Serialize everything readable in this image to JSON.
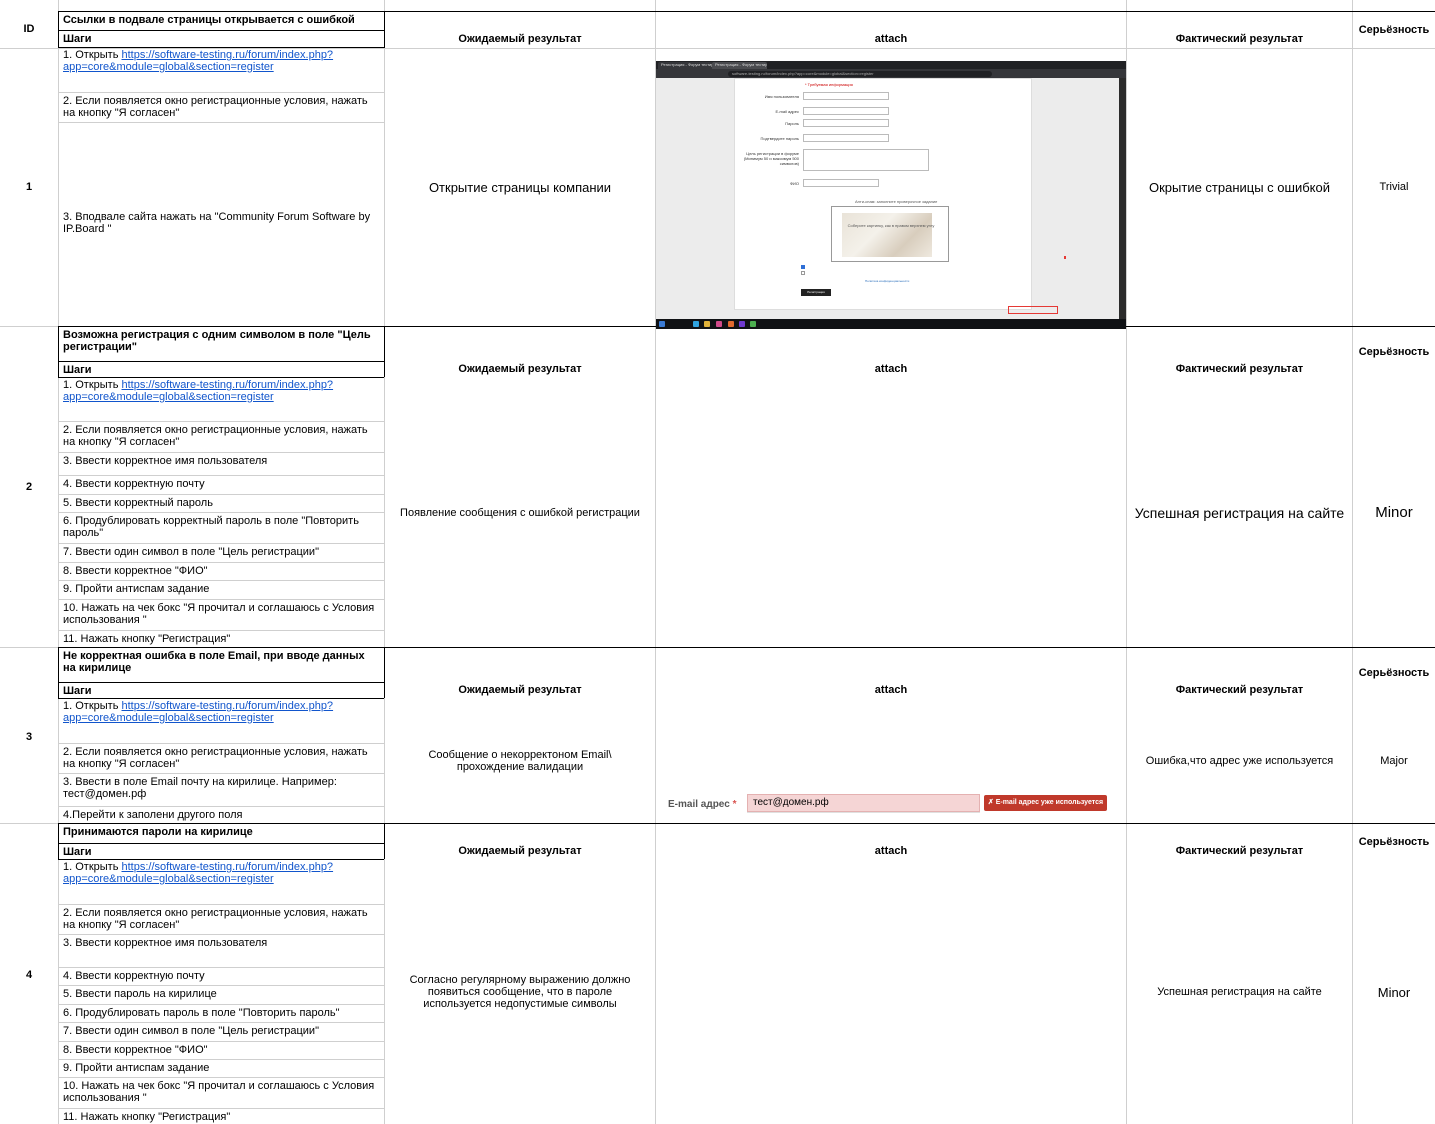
{
  "headers": {
    "id": "ID",
    "steps": "Шаги",
    "expected": "Ожидаемый результат",
    "attach": "attach",
    "actual": "Фактический результат",
    "severity": "Серьёзность"
  },
  "link_url": "https://software-testing.ru/forum/index.php?app=core&module=global&section=register",
  "cases": [
    {
      "id": "1",
      "title": "Ссылки в подвале страницы  открывается с ошибкой",
      "steps": [
        {
          "pre": "1. Открыть ",
          "link1": "https://software-testing.ru/forum/index.php?",
          "link2": "app=core&module=global&section=register"
        },
        {
          "text": "2. Если появляется окно регистрационные условия, нажать на кнопку \"Я согласен\""
        },
        {
          "text": "3. Вподвале сайта нажать на \"Community Forum Software by IP.Board \""
        }
      ],
      "expected": "Открытие страницы компании",
      "actual": "Окрытие страницы с ошибкой",
      "severity": "Trivial"
    },
    {
      "id": "2",
      "title": "Возможна регистрация с одним символом в поле \"Цель регистрации\"",
      "steps": [
        {
          "pre": "1. Открыть ",
          "link1": "https://software-testing.ru/forum/index.php?",
          "link2": "app=core&module=global&section=register"
        },
        {
          "text": "2. Если появляется окно регистрационные условия, нажать на кнопку \"Я согласен\""
        },
        {
          "text": "3. Ввести корректное имя пользователя"
        },
        {
          "text": "4. Ввести корректную почту"
        },
        {
          "text": "5. Ввести корректный пароль"
        },
        {
          "text": "6. Продублировать корректный пароль в поле \"Повторить пароль\""
        },
        {
          "text": "7. Ввести один символ в поле \"Цель регистрации\""
        },
        {
          "text": "8. Ввести корректное \"ФИО\""
        },
        {
          "text": "9. Пройти антиспам задание"
        },
        {
          "text": "10. Нажать на чек бокс \"Я прочитал и соглашаюсь с Условия использования \""
        },
        {
          "text": "11. Нажать кнопку \"Регистрация\""
        }
      ],
      "expected": "Появление сообщения с ошибкой регистрации",
      "actual": "Успешная регистрация на сайте",
      "severity": "Minor"
    },
    {
      "id": "3",
      "title": "Не корректная ошибка в поле Email, при вводе данных на кирилице",
      "steps": [
        {
          "pre": "1. Открыть ",
          "link1": "https://software-testing.ru/forum/index.php?",
          "link2": "app=core&module=global&section=register"
        },
        {
          "text": "2. Если появляется окно регистрационные условия, нажать на кнопку \"Я согласен\""
        },
        {
          "text": "3. Ввести в поле Email почту на кирилице. Например: тест@домен.рф"
        },
        {
          "text": "4.Перейти к заполени другого поля"
        }
      ],
      "expected": "Сообщение о некорректоном Email\\ прохождение валидации",
      "actual": "Ошибка,что адрес уже используется",
      "severity": "Major"
    },
    {
      "id": "4",
      "title": "Принимаются пароли на кирилице",
      "steps": [
        {
          "pre": "1. Открыть ",
          "link1": "https://software-testing.ru/forum/index.php?",
          "link2": "app=core&module=global&section=register"
        },
        {
          "text": "2. Если появляется окно регистрационные условия, нажать на кнопку \"Я согласен\""
        },
        {
          "text": "3. Ввести корректное имя пользователя"
        },
        {
          "text": "4. Ввести корректную почту"
        },
        {
          "text": "5. Ввести  пароль на кирилице"
        },
        {
          "text": "6. Продублировать  пароль в поле \"Повторить пароль\""
        },
        {
          "text": "7. Ввести один символ в поле \"Цель регистрации\""
        },
        {
          "text": "8. Ввести корректное \"ФИО\""
        },
        {
          "text": "9. Пройти антиспам задание"
        },
        {
          "text": "10. Нажать на чек бокс \"Я прочитал и соглашаюсь с Условия использования \""
        },
        {
          "text": "11. Нажать кнопку \"Регистрация\""
        }
      ],
      "expected": "Согласно регулярному выражению должно появиться сообщение, что в пароле используется недопустимые символы",
      "actual": "Успешная регистрация на сайте",
      "severity": "Minor"
    }
  ],
  "attach_email": {
    "label": "E-mail адрес",
    "star": "*",
    "value": "тест@домен.рф",
    "error": "✗ E-mail адрес уже используется"
  },
  "attach_screenshot": {
    "tab1": "Регистрация - Форум тестир...",
    "tab2": "Регистрация - Форум тестир...",
    "url": "software-testing.ru/forum/index.php?app=core&module=global&section=register",
    "required_note": "* Требуемая информация",
    "fields": [
      "Имя пользователя",
      "E-mail адрес",
      "Пароль",
      "Подтвердите пароль",
      "Цель регистрации в форуме (Минимум 50 и максимум 500 символов)",
      "ФИО"
    ],
    "antispam": "Анти-спам: заполните проверочное задание",
    "captcha": "Соберите картинку, как в правом верхнем углу",
    "register_button": "Регистрация",
    "privacy": "Политика конфиденциальности"
  },
  "icons": [
    "open-external-icon",
    "checkbox-icon",
    "windows-start-icon"
  ],
  "colors": {
    "link": "#1155cc",
    "error_badge": "#c0392b",
    "error_input": "#f5d5d5",
    "required_star": "#d9534f"
  }
}
